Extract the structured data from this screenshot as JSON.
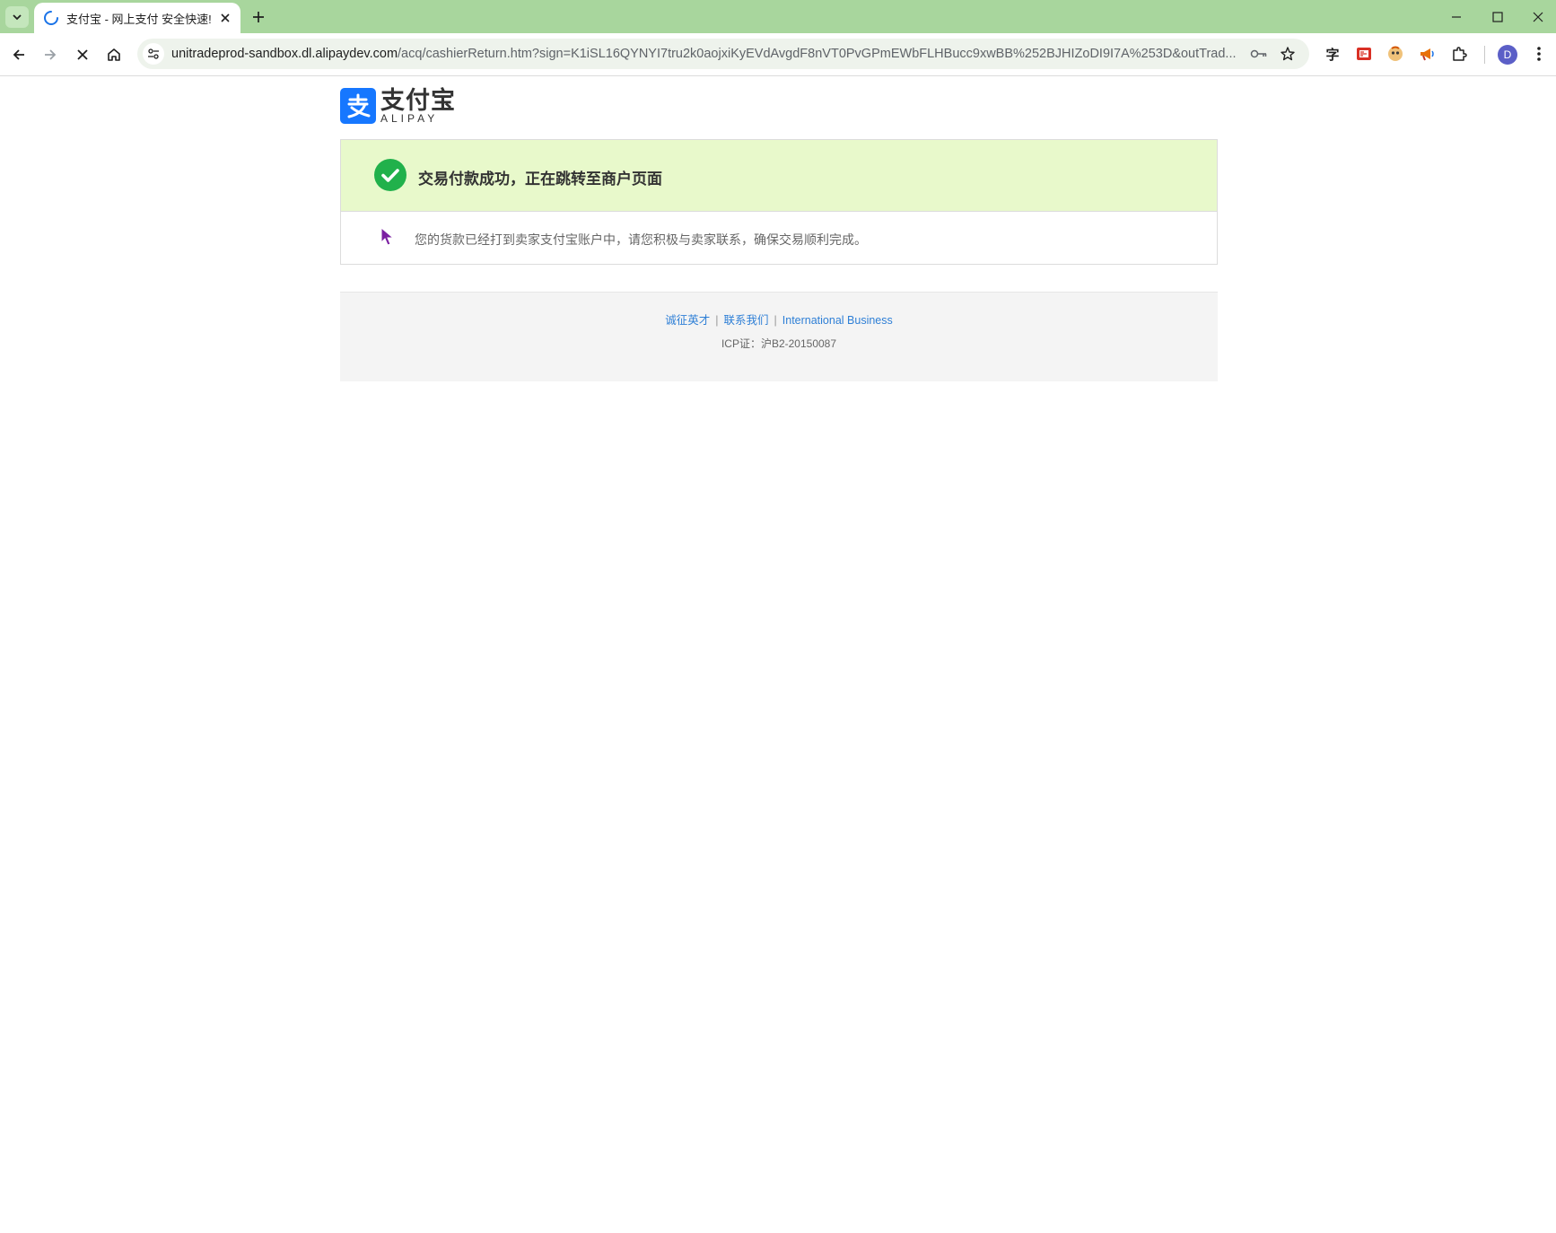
{
  "browser": {
    "tab": {
      "title": "支付宝 - 网上支付 安全快速!"
    },
    "url": {
      "host": "unitradeprod-sandbox.dl.alipaydev.com",
      "path": "/acq/cashierReturn.htm?sign=K1iSL16QYNYI7tru2k0aojxiKyEVdAvgdF8nVT0PvGPmEWbFLHBucc9xwBB%252BJHIZoDI9I7A%253D&outTrad..."
    },
    "profile_initial": "D",
    "extensions": [
      "translate-icon",
      "pdf-extension-icon",
      "avatar-extension-icon",
      "megaphone-extension-icon",
      "puzzle-icon"
    ]
  },
  "page": {
    "logo": {
      "cn": "支付宝",
      "en": "ALIPAY"
    },
    "result": {
      "title": "交易付款成功，正在跳转至商户页面",
      "message": "您的货款已经打到卖家支付宝账户中，请您积极与卖家联系，确保交易顺利完成。"
    },
    "footer": {
      "links": [
        "诚征英才",
        "联系我们",
        "International Business"
      ],
      "separator": "|",
      "icp": "ICP证：沪B2-20150087"
    }
  },
  "colors": {
    "tabstrip": "#a8d69d",
    "success_banner": "#e8f9cb",
    "success_icon": "#21b14b",
    "alipay_blue": "#1677ff",
    "link": "#2e7fd6"
  }
}
